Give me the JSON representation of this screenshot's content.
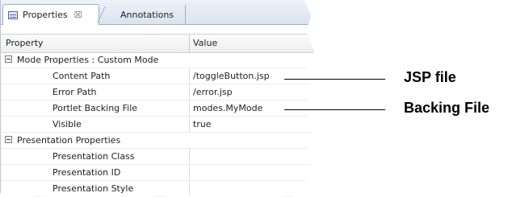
{
  "tabs": {
    "properties_label": "Properties",
    "close_glyph": "☒",
    "annotations_label": "Annotations"
  },
  "header": {
    "property": "Property",
    "value": "Value"
  },
  "rows": [
    {
      "kind": "group",
      "label": "Mode Properties : Custom Mode",
      "value": ""
    },
    {
      "kind": "item",
      "label": "Content Path",
      "value": "/toggleButton.jsp"
    },
    {
      "kind": "item",
      "label": "Error Path",
      "value": "/error.jsp"
    },
    {
      "kind": "item",
      "label": "Portlet Backing File",
      "value": "modes.MyMode"
    },
    {
      "kind": "item",
      "label": "Visible",
      "value": "true"
    },
    {
      "kind": "group",
      "label": "Presentation Properties",
      "value": ""
    },
    {
      "kind": "item",
      "label": "Presentation Class",
      "value": ""
    },
    {
      "kind": "item",
      "label": "Presentation ID",
      "value": ""
    },
    {
      "kind": "item",
      "label": "Presentation Style",
      "value": ""
    }
  ],
  "callouts": {
    "jsp": "JSP file",
    "backing": "Backing File"
  }
}
